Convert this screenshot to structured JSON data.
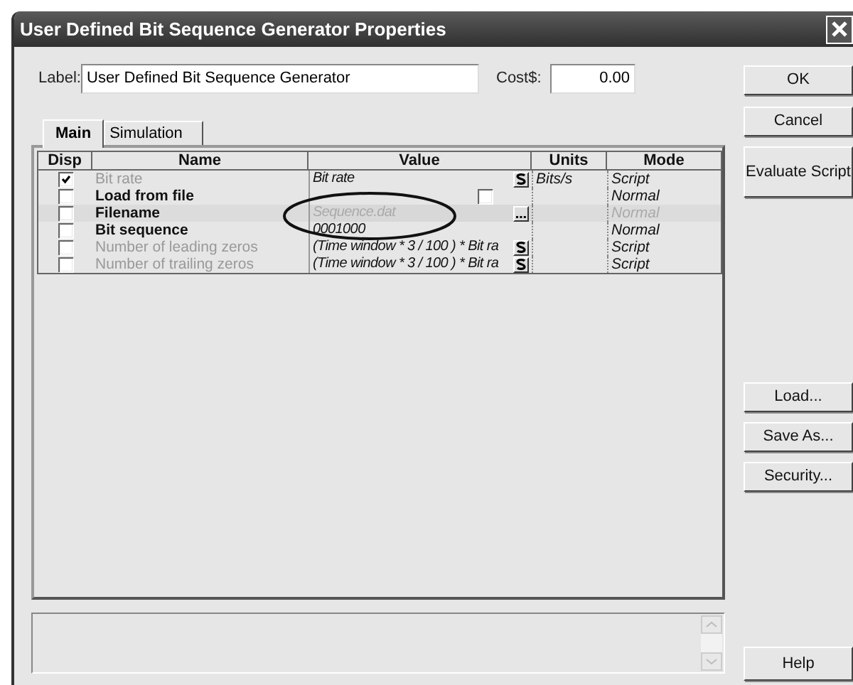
{
  "window": {
    "title": "User Defined Bit Sequence Generator Properties"
  },
  "label_field": {
    "label": "Label:",
    "value": "User Defined Bit Sequence Generator"
  },
  "cost_field": {
    "label": "Cost$:",
    "value": "0.00"
  },
  "tabs": [
    {
      "label": "Main",
      "selected": true
    },
    {
      "label": "Simulation",
      "selected": false
    }
  ],
  "table": {
    "columns": [
      "Disp",
      "Name",
      "Value",
      "Units",
      "Mode"
    ],
    "rows": [
      {
        "displayed": true,
        "name": "Bit rate",
        "disabled": true,
        "value": "Bit rate",
        "kind": "script",
        "value_disabled": false,
        "units": "Bits/s",
        "mode": "Script"
      },
      {
        "displayed": false,
        "name": "Load from file",
        "disabled": false,
        "kind": "checkbox",
        "checked": false,
        "value_disabled": false,
        "mode": "Normal"
      },
      {
        "displayed": false,
        "name": "Filename",
        "disabled": false,
        "value": "Sequence.dat",
        "kind": "browse",
        "value_disabled": true,
        "mode": "Normal"
      },
      {
        "displayed": false,
        "name": "Bit sequence",
        "disabled": false,
        "value": "0001000",
        "kind": "text",
        "value_disabled": false,
        "mode": "Normal"
      },
      {
        "displayed": false,
        "name": "Number of leading zeros",
        "disabled": true,
        "value": "(Time window * 3 / 100 ) * Bit ra",
        "kind": "script",
        "value_disabled": false,
        "mode": "Script"
      },
      {
        "displayed": false,
        "name": "Number of trailing zeros",
        "disabled": true,
        "value": "(Time window * 3 / 100 ) * Bit ra",
        "kind": "script",
        "value_disabled": false,
        "mode": "Script"
      }
    ]
  },
  "buttons": [
    {
      "label": "OK",
      "kind": "top"
    },
    {
      "label": "Cancel",
      "kind": "top"
    },
    {
      "label": "Evaluate Script",
      "kind": "tall"
    },
    {
      "label": "Load...",
      "kind": "gap"
    },
    {
      "label": "Save As...",
      "kind": "plain"
    },
    {
      "label": "Security...",
      "kind": "plain"
    },
    {
      "label": "Help",
      "kind": "bottom"
    }
  ]
}
